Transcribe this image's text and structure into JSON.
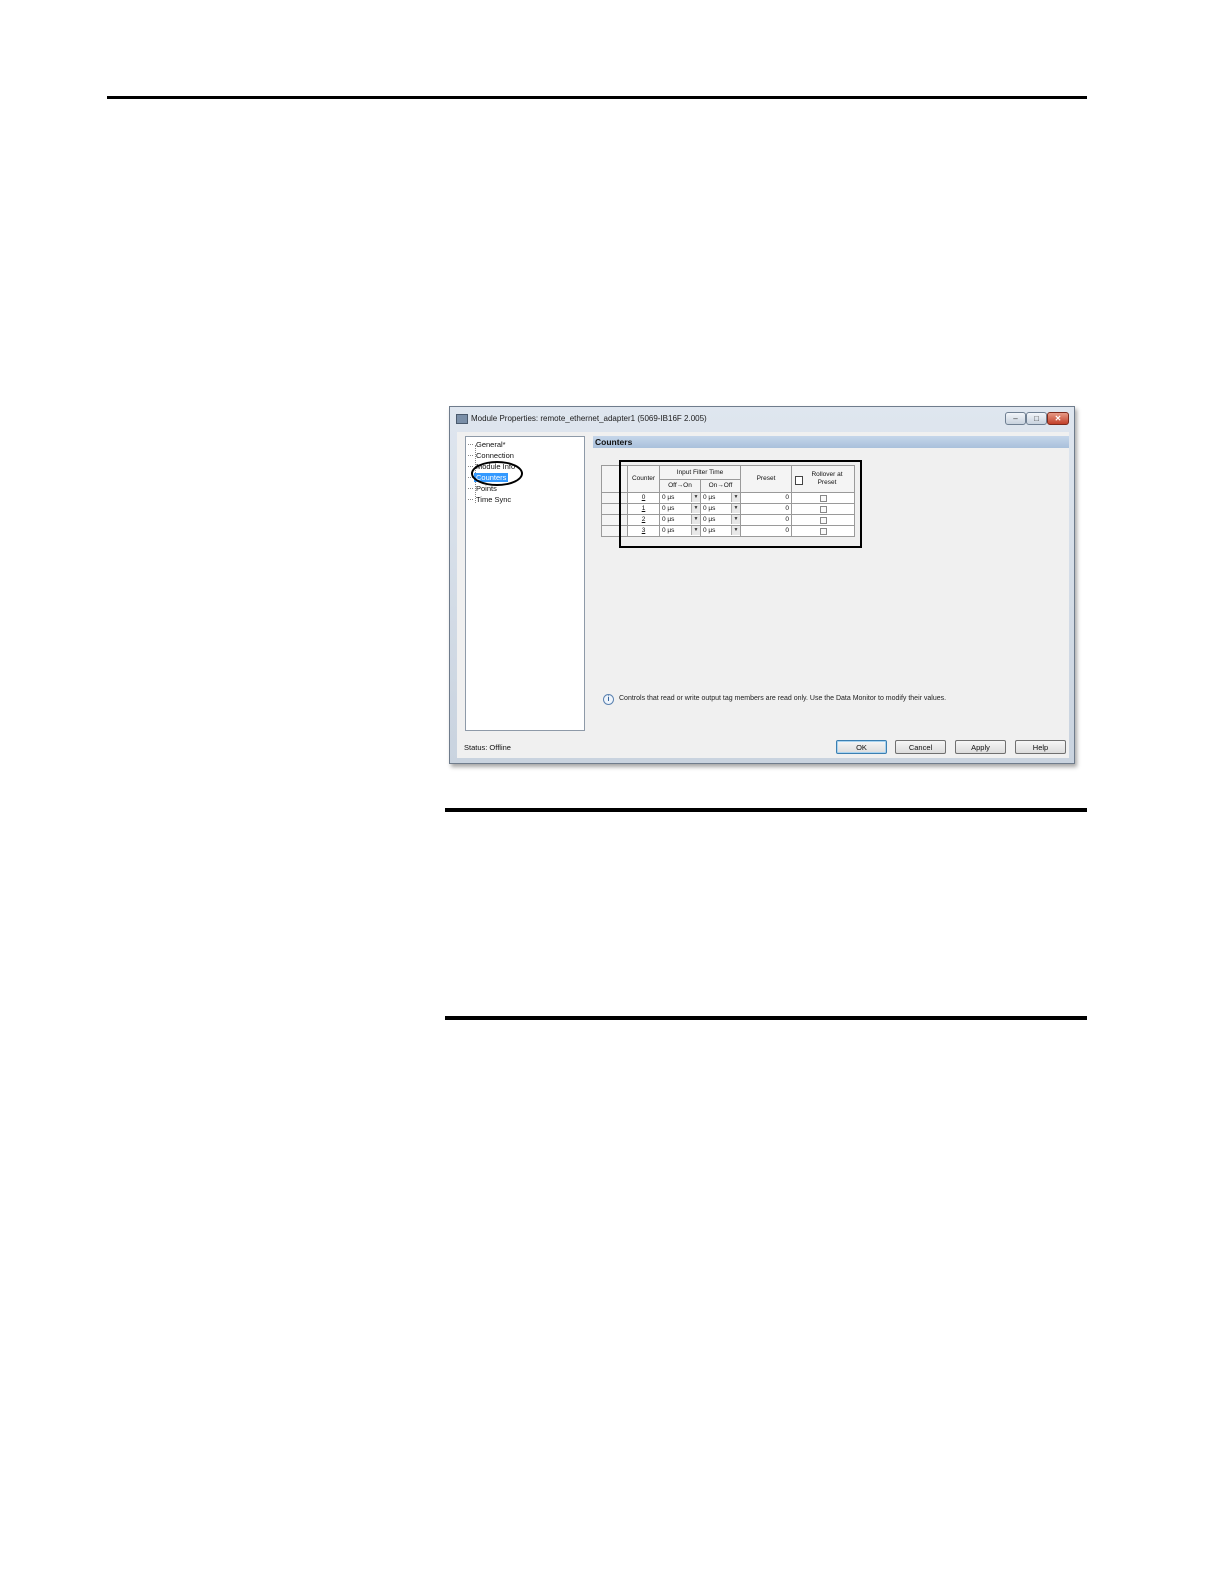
{
  "window": {
    "title": "Module Properties: remote_ethernet_adapter1 (5069-IB16F 2.005)",
    "min_glyph": "–",
    "max_glyph": "□",
    "close_glyph": "✕"
  },
  "tree": {
    "items": [
      "General*",
      "Connection",
      "Module Info",
      "Counters",
      "Points",
      "Time Sync"
    ],
    "selected": "Counters"
  },
  "panel": {
    "title": "Counters"
  },
  "counters_table": {
    "headers": {
      "counter": "Counter",
      "input_filter_time": "Input Filter Time",
      "off_on": "Off→On",
      "on_off": "On→Off",
      "preset": "Preset",
      "rollover": "Rollover at Preset"
    },
    "rows": [
      {
        "counter": "0",
        "off_on": "0 µs",
        "on_off": "0 µs",
        "preset": "0"
      },
      {
        "counter": "1",
        "off_on": "0 µs",
        "on_off": "0 µs",
        "preset": "0"
      },
      {
        "counter": "2",
        "off_on": "0 µs",
        "on_off": "0 µs",
        "preset": "0"
      },
      {
        "counter": "3",
        "off_on": "0 µs",
        "on_off": "0 µs",
        "preset": "0"
      }
    ]
  },
  "info": {
    "icon": "info-icon",
    "text": "Controls that read or write output tag members are read only. Use the Data Monitor to modify their values."
  },
  "status": "Status:  Offline",
  "buttons": {
    "ok": "OK",
    "cancel": "Cancel",
    "apply": "Apply",
    "help": "Help"
  }
}
